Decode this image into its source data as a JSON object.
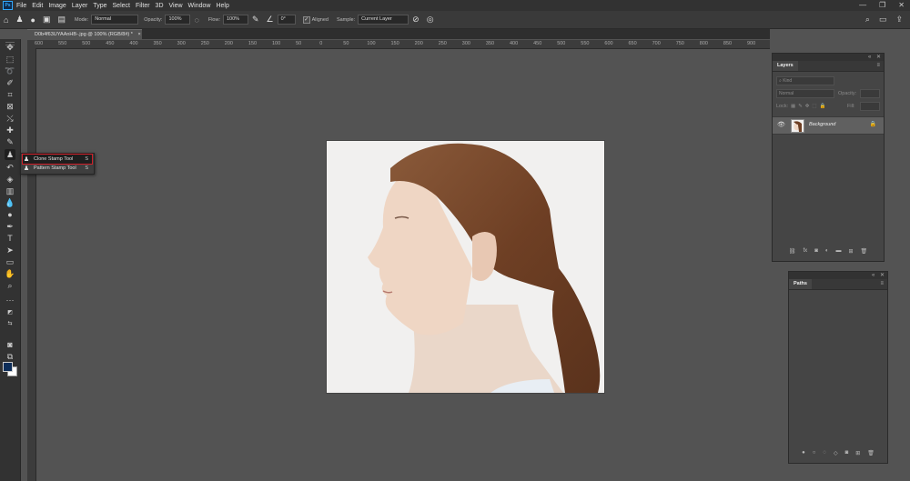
{
  "menubar": {
    "logo": "Ps",
    "items": [
      "File",
      "Edit",
      "Image",
      "Layer",
      "Type",
      "Select",
      "Filter",
      "3D",
      "View",
      "Window",
      "Help"
    ],
    "window_controls": [
      "—",
      "❐",
      "✕"
    ]
  },
  "options": {
    "mode_label": "Mode:",
    "mode_value": "Normal",
    "opacity_label": "Opacity:",
    "opacity_value": "100%",
    "flow_label": "Flow:",
    "flow_value": "100%",
    "angle_value": "0°",
    "aligned_label": "Aligned",
    "sample_label": "Sample:",
    "sample_value": "Current Layer"
  },
  "document": {
    "tab_title": "D0b4f63UYAAnHB-.jpg @ 100% (RGB/8#) *",
    "tab_close": "×"
  },
  "ruler": {
    "ticks": [
      "600",
      "550",
      "500",
      "450",
      "400",
      "350",
      "300",
      "250",
      "200",
      "150",
      "100",
      "50",
      "0",
      "50",
      "100",
      "150",
      "200",
      "250",
      "300",
      "350",
      "400",
      "450",
      "500",
      "550",
      "600",
      "650",
      "700",
      "750",
      "800",
      "850",
      "900",
      "950",
      "1000",
      "1050",
      "1100",
      "1150"
    ]
  },
  "flyout": {
    "selected_label": "Clone Stamp Tool",
    "selected_key": "S",
    "other_label": "Pattern Stamp Tool",
    "other_key": "S"
  },
  "layers_panel": {
    "tab": "Layers",
    "search_placeholder": "Kind",
    "blend_mode": "Normal",
    "opacity_label": "Opacity:",
    "lock_label": "Lock:",
    "fill_label": "Fill:",
    "layer_name": "Background"
  },
  "paths_panel": {
    "tab": "Paths"
  },
  "colors": {
    "foreground": "#0d2d59",
    "background": "#ffffff",
    "selection_outline": "#d0202a"
  }
}
